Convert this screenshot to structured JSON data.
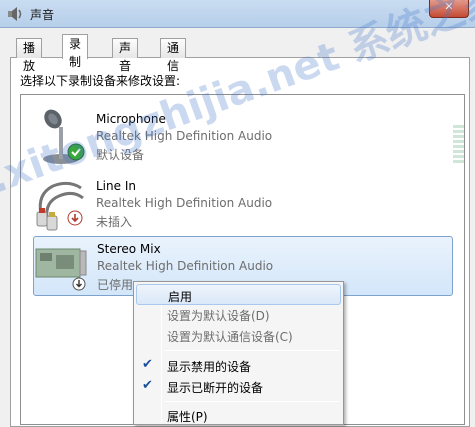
{
  "window": {
    "title": "声音",
    "app_icon": "speaker-icon",
    "close_icon": "close-icon"
  },
  "tabs": [
    {
      "label": "播放"
    },
    {
      "label": "录制",
      "active": true
    },
    {
      "label": "声音"
    },
    {
      "label": "通信"
    }
  ],
  "instruction": "选择以下录制设备来修改设置:",
  "devices": [
    {
      "name": "Microphone",
      "driver": "Realtek High Definition Audio",
      "status": "默认设备",
      "icon": "microphone-icon",
      "badge": "default-check-icon"
    },
    {
      "name": "Line In",
      "driver": "Realtek High Definition Audio",
      "status": "未插入",
      "icon": "audio-jack-icon",
      "badge": "unplugged-icon"
    },
    {
      "name": "Stereo Mix",
      "driver": "Realtek High Definition Audio",
      "status": "已停用",
      "icon": "sound-card-icon",
      "badge": "disabled-icon",
      "selected": true
    }
  ],
  "context_menu": {
    "items": [
      {
        "label": "启用",
        "highlight": true
      },
      {
        "label": "设置为默认设备(D)",
        "disabled": true
      },
      {
        "label": "设置为默认通信设备(C)",
        "disabled": true
      },
      {
        "label": "显示禁用的设备",
        "checked": true
      },
      {
        "label": "显示已断开的设备",
        "checked": true
      },
      {
        "label": "属性(P)"
      }
    ]
  },
  "watermark": ".xitongzhijia.net 系统之家原创www"
}
